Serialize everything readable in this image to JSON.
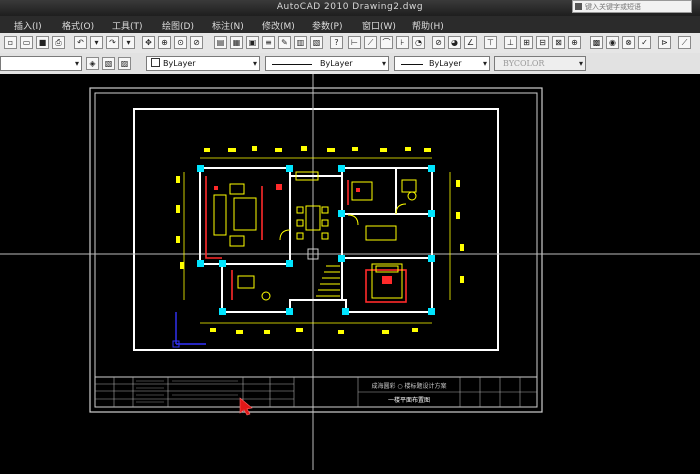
{
  "window": {
    "title": "AutoCAD 2010    Drawing2.dwg"
  },
  "search": {
    "placeholder": "键入关键字或短语"
  },
  "menu": {
    "items": [
      "插入(I)",
      "格式(O)",
      "工具(T)",
      "绘图(D)",
      "标注(N)",
      "修改(M)",
      "参数(P)",
      "窗口(W)",
      "帮助(H)"
    ]
  },
  "properties": {
    "color": "ByLayer",
    "linetype": "ByLayer",
    "lineweight": "ByLayer",
    "plotstyle": "BYCOLOR"
  },
  "titleblock": {
    "project": "成海圆彩 ○ 楼标题设计方案",
    "sheet": "一楼平面布置图"
  },
  "colors": {
    "wall": "#ffffff",
    "furniture": "#ffff00",
    "accent": "#ff2a2a",
    "column": "#00e5ff",
    "ucs": "#3333ff"
  }
}
